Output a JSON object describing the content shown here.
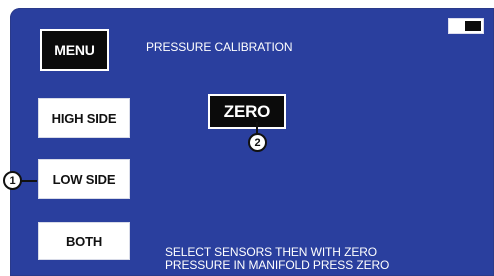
{
  "screen": {
    "title": "PRESSURE CALIBRATION",
    "instructions_line1": "SELECT SENSORS THEN WITH ZERO",
    "instructions_line2": "PRESSURE IN MANIFOLD PRESS ZERO"
  },
  "buttons": {
    "menu": "MENU",
    "high_side": "HIGH SIDE",
    "low_side": "LOW SIDE",
    "both": "BOTH",
    "zero": "ZERO"
  },
  "callouts": {
    "one": "1",
    "two": "2"
  },
  "icons": {
    "battery": "battery-icon"
  },
  "colors": {
    "screen_background": "#2a3f9e",
    "selected_button": "#0b0b0b",
    "unselected_button": "#ffffff"
  }
}
